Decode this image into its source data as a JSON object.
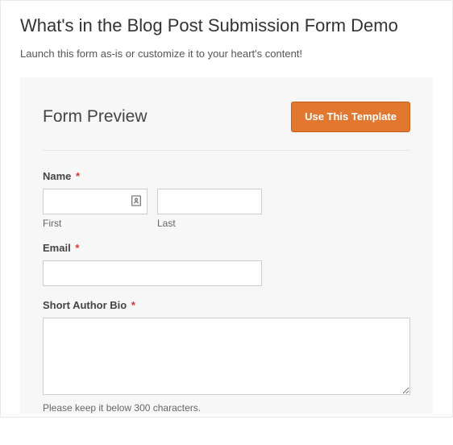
{
  "page": {
    "title": "What's in the Blog Post Submission Form Demo",
    "intro": "Launch this form as-is or customize it to your heart's content!"
  },
  "preview": {
    "heading": "Form Preview",
    "cta_label": "Use This Template"
  },
  "form": {
    "name": {
      "label": "Name",
      "required_mark": "*",
      "first_sublabel": "First",
      "last_sublabel": "Last",
      "first_value": "",
      "last_value": ""
    },
    "email": {
      "label": "Email",
      "required_mark": "*",
      "value": ""
    },
    "bio": {
      "label": "Short Author Bio",
      "required_mark": "*",
      "value": "",
      "helper": "Please keep it below 300 characters."
    }
  },
  "colors": {
    "accent": "#e27730",
    "required": "#d63638"
  }
}
